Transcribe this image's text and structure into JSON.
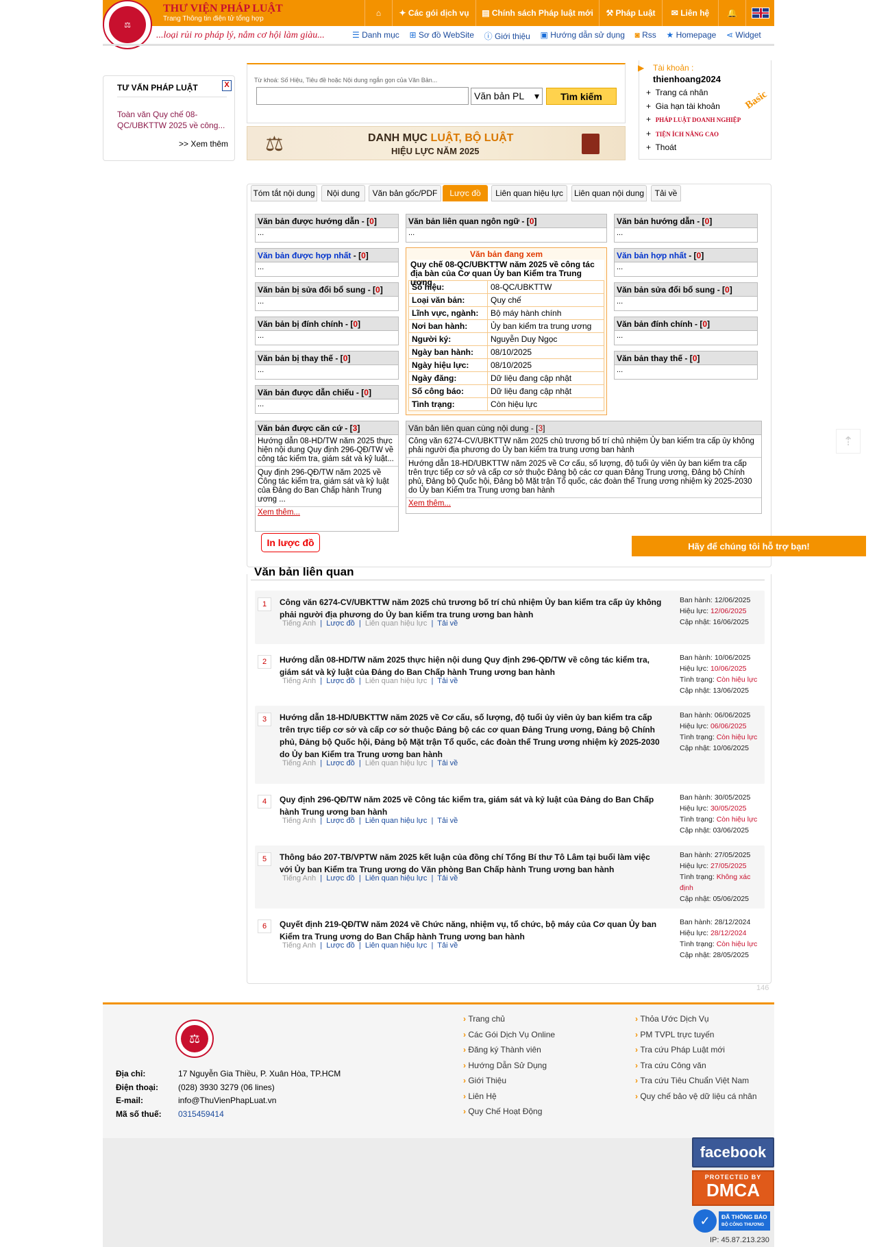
{
  "header": {
    "brand": "THƯ VIỆN PHÁP LUẬT",
    "brand_sub": "Trang Thông tin điện tử tổng hợp",
    "slogan": "...loại rủi ro pháp lý, nắm cơ hội làm giàu...",
    "nav": [
      "Các gói dịch vụ",
      "Chính sách Pháp luật mới",
      "Pháp Luật",
      "Liên hệ"
    ],
    "subnav": [
      "Danh mục",
      "Sơ đồ WebSite",
      "Giới thiệu",
      "Hướng dẫn sử dụng",
      "Rss",
      "Homepage",
      "Widget"
    ]
  },
  "advice": {
    "title": "TƯ VẤN PHÁP LUẬT",
    "close": "X",
    "link": "Toàn văn Quy chế 08-QC/UBKTTW 2025 về công...",
    "more": ">> Xem thêm"
  },
  "search": {
    "hint": "Từ khoá: Số Hiệu, Tiêu đề hoặc Nội dung ngắn gọn của Văn Bản...",
    "select": "Văn bản PL",
    "button": "Tìm kiếm",
    "value": ""
  },
  "banner": {
    "line1a": "DANH MỤC ",
    "line1b": "LUẬT, BỘ LUẬT",
    "line2": "HIỆU LỰC NĂM 2025"
  },
  "account": {
    "label": "Tài khoản :",
    "user": "thienhoang2024",
    "badge": "Basic",
    "items": [
      "Trang cá nhân",
      "Gia hạn tài khoản",
      "PHÁP LUẬT DOANH NGHIỆP",
      "TIỆN ÍCH NÂNG CAO",
      "Thoát"
    ]
  },
  "tabs": [
    "Tóm tắt nội dung",
    "Nội dung",
    "Văn bản gốc/PDF",
    "Lược đồ",
    "Liên quan hiệu lực",
    "Liên quan nội dung",
    "Tải về"
  ],
  "diagram": {
    "left": [
      {
        "t": "Văn bản được hướng dẫn",
        "n": "0"
      },
      {
        "t": "Văn bản được hợp nhất",
        "n": "0"
      },
      {
        "t": "Văn bản bị sửa đổi bổ sung",
        "n": "0"
      },
      {
        "t": "Văn bản bị đính chính",
        "n": "0"
      },
      {
        "t": "Văn bản bị thay thế",
        "n": "0"
      },
      {
        "t": "Văn bản được dẫn chiếu",
        "n": "0"
      }
    ],
    "right": [
      {
        "t": "Văn bản hướng dẫn",
        "n": "0"
      },
      {
        "t": "Văn bản hợp nhất",
        "n": "0"
      },
      {
        "t": "Văn bản sửa đổi bổ sung",
        "n": "0"
      },
      {
        "t": "Văn bản đính chính",
        "n": "0"
      },
      {
        "t": "Văn bản thay thế",
        "n": "0"
      }
    ],
    "lang": {
      "t": "Văn bản liên quan ngôn ngữ",
      "n": "0"
    },
    "empty": "...",
    "current": {
      "header": "Văn bản đang xem",
      "title": "Quy chế 08-QC/UBKTTW năm 2025 về công tác địa bàn của Cơ quan Ủy ban Kiểm tra Trung ương",
      "rows": [
        [
          "Số hiệu:",
          "08-QC/UBKTTW"
        ],
        [
          "Loại văn bản:",
          "Quy chế"
        ],
        [
          "Lĩnh vực, ngành:",
          "Bộ máy hành chính"
        ],
        [
          "Nơi ban hành:",
          "Ủy ban kiểm tra trung ương"
        ],
        [
          "Người ký:",
          "Nguyễn Duy Ngọc"
        ],
        [
          "Ngày ban hành:",
          "08/10/2025"
        ],
        [
          "Ngày hiệu lực:",
          "08/10/2025"
        ],
        [
          "Ngày đăng:",
          "Dữ liệu đang cập nhật"
        ],
        [
          "Số công báo:",
          "Dữ liệu đang cập nhật"
        ],
        [
          "Tình trạng:",
          "Còn hiệu lực"
        ]
      ]
    },
    "based": {
      "t": "Văn bản được căn cứ",
      "n": "3",
      "items": [
        "Hướng dẫn 08-HD/TW năm 2025 thực hiện nội dung Quy định 296-QĐ/TW về công tác kiểm tra, giám sát và kỷ luật...",
        "Quy định 296-QĐ/TW năm 2025 về Công tác kiểm tra, giám sát và kỷ luật của Đảng do Ban Chấp hành Trung ương ..."
      ],
      "more": "Xem thêm..."
    },
    "same": {
      "t": "Văn bản liên quan cùng nội dung",
      "n": "3",
      "items": [
        "Công văn 6274-CV/UBKTTW năm 2025 chủ trương bố trí chủ nhiệm Ủy ban kiểm tra cấp ủy không phải người địa phương do Ủy ban kiểm tra trung ương ban hành",
        "Hướng dẫn 18-HD/UBKTTW năm 2025 về Cơ cấu, số lượng, độ tuổi ủy viên ủy ban kiểm tra cấp trên trực tiếp cơ sở và cấp cơ sở thuộc Đảng bộ các cơ quan Đảng Trung ương, Đảng bộ Chính phủ, Đảng bộ Quốc hội, Đảng bộ Mặt trận Tổ quốc, các đoàn thể Trung ương nhiệm kỳ 2025-2030 do Ủy ban Kiểm tra Trung ương ban hành"
      ],
      "more": "Xem thêm..."
    },
    "print": "In lược đồ"
  },
  "support": "Hãy để chúng tôi hỗ trợ bạn!",
  "related": {
    "title": "Văn bản liên quan",
    "links": [
      "Tiếng Anh",
      "Lược đồ",
      "Liên quan hiệu lực",
      "Tải về"
    ],
    "labels": {
      "issued": "Ban hành:",
      "effective": "Hiệu lực:",
      "status": "Tình trạng:",
      "updated": "Cập nhật:"
    },
    "items": [
      {
        "n": "1",
        "title": "Công văn 6274-CV/UBKTTW năm 2025 chủ trương bố trí chủ nhiệm Ủy ban kiểm tra cấp ủy không phải người địa phương do Ủy ban kiểm tra trung ương ban hành",
        "issued": "12/06/2025",
        "effective": "12/06/2025",
        "status": "",
        "updated": "16/06/2025"
      },
      {
        "n": "2",
        "title": "Hướng dẫn 08-HD/TW năm 2025 thực hiện nội dung Quy định 296-QĐ/TW về công tác kiểm tra, giám sát và kỷ luật của Đảng do Ban Chấp hành Trung ương ban hành",
        "issued": "10/06/2025",
        "effective": "10/06/2025",
        "status": "Còn hiệu lực",
        "updated": "13/06/2025"
      },
      {
        "n": "3",
        "title": "Hướng dẫn 18-HD/UBKTTW năm 2025 về Cơ cấu, số lượng, độ tuổi ủy viên ủy ban kiểm tra cấp trên trực tiếp cơ sở và cấp cơ sở thuộc Đảng bộ các cơ quan Đảng Trung ương, Đảng bộ Chính phủ, Đảng bộ Quốc hội, Đảng bộ Mặt trận Tổ quốc, các đoàn thể Trung ương nhiệm kỳ 2025-2030 do Ủy ban Kiểm tra Trung ương ban hành",
        "issued": "06/06/2025",
        "effective": "06/06/2025",
        "status": "Còn hiệu lực",
        "updated": "10/06/2025"
      },
      {
        "n": "4",
        "title": "Quy định 296-QĐ/TW năm 2025 về Công tác kiểm tra, giám sát và kỷ luật của Đảng do Ban Chấp hành Trung ương ban hành",
        "issued": "30/05/2025",
        "effective": "30/05/2025",
        "status": "Còn hiệu lực",
        "updated": "03/06/2025"
      },
      {
        "n": "5",
        "title": "Thông báo 207-TB/VPTW năm 2025 kết luận của đồng chí Tổng Bí thư Tô Lâm tại buổi làm việc với Ủy ban Kiểm tra Trung ương do Văn phòng Ban Chấp hành Trung ương ban hành",
        "issued": "27/05/2025",
        "effective": "27/05/2025",
        "status": "Không xác định",
        "updated": "05/06/2025"
      },
      {
        "n": "6",
        "title": "Quyết định 219-QĐ/TW năm 2024 về Chức năng, nhiệm vụ, tổ chức, bộ máy của Cơ quan Ủy ban Kiểm tra Trung ương do Ban Chấp hành Trung ương ban hành",
        "issued": "28/12/2024",
        "effective": "28/12/2024",
        "status": "Còn hiệu lực",
        "updated": "28/05/2025"
      }
    ]
  },
  "counter": "146",
  "footer": {
    "address_label": "Địa chỉ:",
    "address": "17 Nguyễn Gia Thiều, P. Xuân Hòa, TP.HCM",
    "phone_label": "Điện thoại:",
    "phone": "(028) 3930 3279 (06 lines)",
    "email_label": "E-mail:",
    "email": "info@ThuVienPhapLuat.vn",
    "tax_label": "Mã số thuế:",
    "tax": "0315459414",
    "col1": [
      "Trang chủ",
      "Các Gói Dịch Vụ Online",
      "Đăng ký Thành viên",
      "Hướng Dẫn Sử Dụng",
      "Giới Thiệu",
      "Liên Hệ",
      "Quy Chế Hoạt Động"
    ],
    "col2": [
      "Thỏa Ước Dịch Vụ",
      "PM TVPL trực tuyến",
      "Tra cứu Pháp Luật mới",
      "Tra cứu Công văn",
      "Tra cứu Tiêu Chuẩn Việt Nam",
      "Quy chế bảo vệ dữ liệu cá nhân"
    ],
    "facebook": "facebook",
    "dmca_top": "PROTECTED BY",
    "dmca": "DMCA",
    "bct1": "ĐÃ THÔNG BÁO",
    "bct2": "BỘ CÔNG THƯƠNG",
    "ip": "IP: 45.87.213.230"
  },
  "colors": {
    "accent": "#f39200",
    "brand_red": "#c8102e",
    "link_blue": "#1a4a9c"
  }
}
